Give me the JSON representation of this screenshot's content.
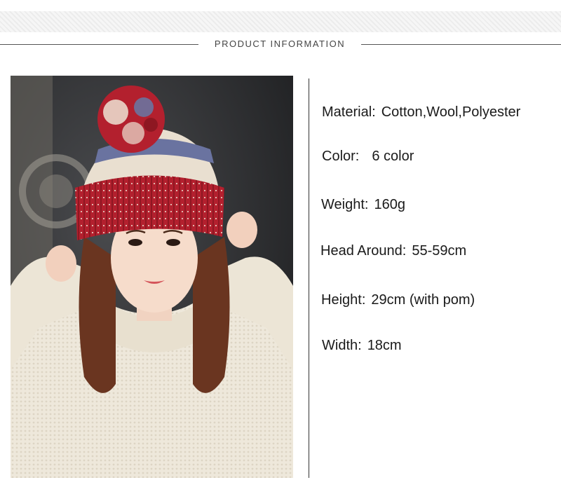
{
  "header": {
    "title": "PRODUCT INFORMATION"
  },
  "photo": {
    "subject": "Woman wearing a red, cream and blue knitted pom-pom beanie and cream cable-knit sweater",
    "colors": {
      "hat_red": "#b3202e",
      "hat_cream": "#e9dfd0",
      "hat_blue": "#6a73a0",
      "sweater": "#eee8db",
      "hair": "#6a3520",
      "background": "#2c2d2f"
    }
  },
  "specs": [
    {
      "label": "Material:",
      "value": "Cotton,Wool,Polyester"
    },
    {
      "label": "Color:",
      "value": "6 color"
    },
    {
      "label": "Weight:",
      "value": "160g"
    },
    {
      "label": "Head Around:",
      "value": "55-59cm"
    },
    {
      "label": "Height:",
      "value": "29cm (with pom)"
    },
    {
      "label": "Width:",
      "value": "18cm"
    }
  ]
}
